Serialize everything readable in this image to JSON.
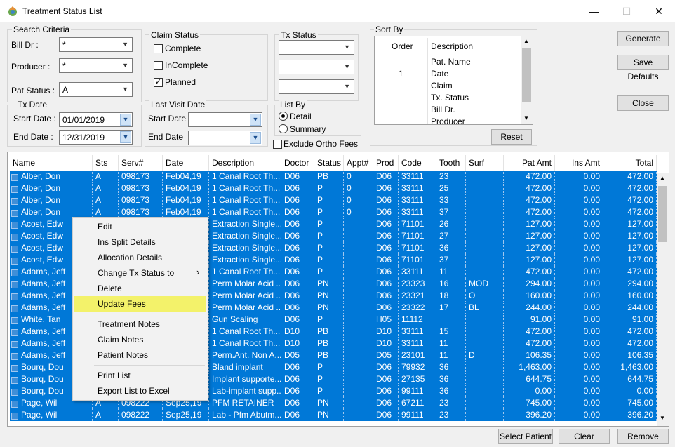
{
  "window": {
    "title": "Treatment Status List",
    "min": "—",
    "max": "☐",
    "close": "✕"
  },
  "search": {
    "label": "Search Criteria",
    "bill_dr_label": "Bill Dr :",
    "bill_dr_value": "*",
    "producer_label": "Producer :",
    "producer_value": "*",
    "pat_status_label": "Pat Status :",
    "pat_status_value": "A"
  },
  "claim_status": {
    "label": "Claim Status",
    "complete": "Complete",
    "incomplete": "InComplete",
    "planned": "Planned"
  },
  "tx_status": {
    "label": "Tx Status"
  },
  "tx_date": {
    "label": "Tx Date",
    "start_label": "Start Date :",
    "start_value": "01/01/2019",
    "end_label": "End Date :",
    "end_value": "12/31/2019"
  },
  "last_visit": {
    "label": "Last Visit Date",
    "start_label": "Start Date",
    "end_label": "End Date"
  },
  "list_by": {
    "label": "List By",
    "detail": "Detail",
    "summary": "Summary"
  },
  "exclude_ortho": "Exclude Ortho Fees",
  "sort_by": {
    "label": "Sort By",
    "col_order": "Order",
    "col_description": "Description",
    "rows": [
      {
        "order": "",
        "desc": "Pat. Name"
      },
      {
        "order": "1",
        "desc": "Date"
      },
      {
        "order": "",
        "desc": "Claim"
      },
      {
        "order": "",
        "desc": "Tx. Status"
      },
      {
        "order": "",
        "desc": "Bill Dr."
      },
      {
        "order": "",
        "desc": "Producer"
      }
    ],
    "reset": "Reset"
  },
  "buttons": {
    "generate": "Generate",
    "save_defaults": "Save Defaults",
    "close": "Close",
    "select_patient": "Select Patient",
    "clear": "Clear",
    "remove": "Remove"
  },
  "grid": {
    "headers": [
      "Name",
      "Sts",
      "Serv#",
      "Date",
      "Description",
      "Doctor",
      "Status",
      "Appt#",
      "Prod",
      "Code",
      "Tooth",
      "Surf",
      "Pat Amt",
      "Ins Amt",
      "Total"
    ],
    "rows": [
      [
        "Alber, Don",
        "A",
        "098173",
        "Feb04,19",
        "1 Canal Root Th...",
        "D06",
        "PB",
        "0",
        "D06",
        "33111",
        "23",
        "",
        "472.00",
        "0.00",
        "472.00"
      ],
      [
        "Alber, Don",
        "A",
        "098173",
        "Feb04,19",
        "1 Canal Root Th...",
        "D06",
        "P",
        "0",
        "D06",
        "33111",
        "25",
        "",
        "472.00",
        "0.00",
        "472.00"
      ],
      [
        "Alber, Don",
        "A",
        "098173",
        "Feb04,19",
        "1 Canal Root Th...",
        "D06",
        "P",
        "0",
        "D06",
        "33111",
        "33",
        "",
        "472.00",
        "0.00",
        "472.00"
      ],
      [
        "Alber, Don",
        "A",
        "098173",
        "Feb04,19",
        "1 Canal Root Th...",
        "D06",
        "P",
        "0",
        "D06",
        "33111",
        "37",
        "",
        "472.00",
        "0.00",
        "472.00"
      ],
      [
        "Acost, Edw",
        "",
        "",
        "",
        "Extraction Single...",
        "D06",
        "P",
        "",
        "D06",
        "71101",
        "26",
        "",
        "127.00",
        "0.00",
        "127.00"
      ],
      [
        "Acost, Edw",
        "",
        "",
        "",
        "Extraction Single...",
        "D06",
        "P",
        "",
        "D06",
        "71101",
        "27",
        "",
        "127.00",
        "0.00",
        "127.00"
      ],
      [
        "Acost, Edw",
        "",
        "",
        "",
        "Extraction Single...",
        "D06",
        "P",
        "",
        "D06",
        "71101",
        "36",
        "",
        "127.00",
        "0.00",
        "127.00"
      ],
      [
        "Acost, Edw",
        "",
        "",
        "",
        "Extraction Single...",
        "D06",
        "P",
        "",
        "D06",
        "71101",
        "37",
        "",
        "127.00",
        "0.00",
        "127.00"
      ],
      [
        "Adams, Jeff",
        "",
        "",
        "",
        "1 Canal Root Th...",
        "D06",
        "P",
        "",
        "D06",
        "33111",
        "11",
        "",
        "472.00",
        "0.00",
        "472.00"
      ],
      [
        "Adams, Jeff",
        "",
        "",
        "",
        "Perm Molar Acid ...",
        "D06",
        "PN",
        "",
        "D06",
        "23323",
        "16",
        "MOD",
        "294.00",
        "0.00",
        "294.00"
      ],
      [
        "Adams, Jeff",
        "",
        "",
        "",
        "Perm Molar Acid ...",
        "D06",
        "PN",
        "",
        "D06",
        "23321",
        "18",
        "O",
        "160.00",
        "0.00",
        "160.00"
      ],
      [
        "Adams, Jeff",
        "",
        "",
        "",
        "Perm Molar Acid ...",
        "D06",
        "PN",
        "",
        "D06",
        "23322",
        "17",
        "BL",
        "244.00",
        "0.00",
        "244.00"
      ],
      [
        "White, Tan",
        "",
        "",
        "",
        "Gun Scaling",
        "D06",
        "P",
        "",
        "H05",
        "11112",
        "",
        "",
        "91.00",
        "0.00",
        "91.00"
      ],
      [
        "Adams, Jeff",
        "",
        "",
        "",
        "1 Canal Root Th...",
        "D10",
        "PB",
        "",
        "D10",
        "33111",
        "15",
        "",
        "472.00",
        "0.00",
        "472.00"
      ],
      [
        "Adams, Jeff",
        "",
        "",
        "",
        "1 Canal Root Th...",
        "D10",
        "PB",
        "",
        "D10",
        "33111",
        "11",
        "",
        "472.00",
        "0.00",
        "472.00"
      ],
      [
        "Adams, Jeff",
        "",
        "",
        "",
        "Perm.Ant. Non A...",
        "D05",
        "PB",
        "",
        "D05",
        "23101",
        "11",
        "D",
        "106.35",
        "0.00",
        "106.35"
      ],
      [
        "Bourq, Dou",
        "",
        "",
        "",
        "Bland implant",
        "D06",
        "P",
        "",
        "D06",
        "79932",
        "36",
        "",
        "1,463.00",
        "0.00",
        "1,463.00"
      ],
      [
        "Bourq, Dou",
        "",
        "",
        "",
        "Implant supporte...",
        "D06",
        "P",
        "",
        "D06",
        "27135",
        "36",
        "",
        "644.75",
        "0.00",
        "644.75"
      ],
      [
        "Bourq, Dou",
        "",
        "",
        "",
        "Lab-implant supp...",
        "D06",
        "P",
        "",
        "D06",
        "99111",
        "36",
        "",
        "0.00",
        "0.00",
        "0.00"
      ],
      [
        "Page, Wil",
        "A",
        "098222",
        "Sep25,19",
        "PFM RETAINER",
        "D06",
        "PN",
        "",
        "D06",
        "67211",
        "23",
        "",
        "745.00",
        "0.00",
        "745.00"
      ],
      [
        "Page, Wil",
        "A",
        "098222",
        "Sep25,19",
        "Lab - Pfm Abutm...",
        "D06",
        "PN",
        "",
        "D06",
        "99111",
        "23",
        "",
        "396.20",
        "0.00",
        "396.20"
      ]
    ]
  },
  "context_menu": {
    "items": [
      "Edit",
      "Ins Split Details",
      "Allocation Details",
      "Change Tx Status to",
      "Delete",
      "Update Fees",
      "Treatment Notes",
      "Claim Notes",
      "Patient Notes",
      "Print List",
      "Export List to Excel"
    ],
    "submenu_arrow": "›",
    "highlight_color": "#f3f26a"
  },
  "colors": {
    "selection": "#0078d7"
  }
}
